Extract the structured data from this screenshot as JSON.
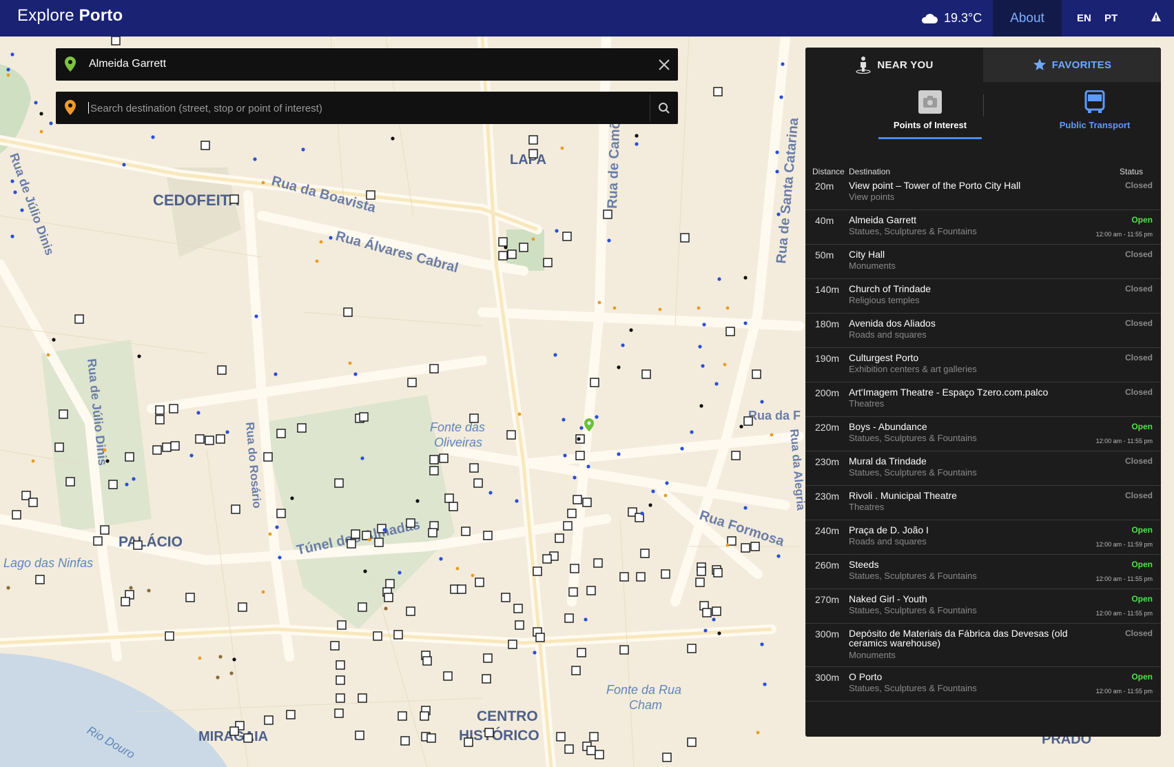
{
  "header": {
    "brand_light": "Explore",
    "brand_bold": "Porto",
    "weather": "19.3°C",
    "about": "About",
    "lang_en": "EN",
    "lang_pt": "PT"
  },
  "search": {
    "origin_value": "Almeida Garrett",
    "destination_placeholder": "Search destination (street, stop or point of interest)"
  },
  "map": {
    "labels": {
      "cedofeita": "CEDOFEITA",
      "lapa": "LAPA",
      "palacio": "PALÁCIO",
      "miragaia": "MIRAGAIA",
      "centro1": "CENTRO",
      "centro2": "HISTÓRICO",
      "prado": "PRADO",
      "boavista": "Rua da Boavista",
      "alvares": "Rua Álvares Cabral",
      "julio1": "Rua de Júlio Dinis",
      "julio2": "Rua de Júlio Dinis",
      "rosario": "Rua do Rosário",
      "almadas": "Túnel dos Almadas",
      "santacatarina": "Rua de Santa Catarina",
      "camoes": "Rua de Camões",
      "alegria": "Rua da Alegria",
      "formosa": "Rua Formosa",
      "ruadaf": "Rua da F",
      "fonte_oliveiras1": "Fonte das",
      "fonte_oliveiras2": "Oliveiras",
      "lago1": "Lago das Ninfas",
      "fonte_rua1": "Fonte da Rua",
      "fonte_rua2": "Cham",
      "rio": "Rio Douro"
    }
  },
  "panel": {
    "tab_near": "NEAR YOU",
    "tab_favorites": "FAVORITES",
    "subtab_poi": "Points of Interest",
    "subtab_transport": "Public Transport",
    "col_distance": "Distance",
    "col_destination": "Destination",
    "col_status": "Status",
    "rows": [
      {
        "dist": "20m",
        "title": "View point – Tower of the Porto City Hall",
        "cat": "View points",
        "status": "Closed",
        "hours": ""
      },
      {
        "dist": "40m",
        "title": "Almeida Garrett",
        "cat": "Statues, Sculptures & Fountains",
        "status": "Open",
        "hours": "12:00 am - 11:55 pm"
      },
      {
        "dist": "50m",
        "title": "City Hall",
        "cat": "Monuments",
        "status": "Closed",
        "hours": ""
      },
      {
        "dist": "140m",
        "title": "Church of Trindade",
        "cat": "Religious temples",
        "status": "Closed",
        "hours": ""
      },
      {
        "dist": "180m",
        "title": "Avenida dos Aliados",
        "cat": "Roads and squares",
        "status": "Closed",
        "hours": ""
      },
      {
        "dist": "190m",
        "title": "Culturgest Porto",
        "cat": "Exhibition centers & art galleries",
        "status": "Closed",
        "hours": ""
      },
      {
        "dist": "200m",
        "title": "Art'Imagem Theatre - Espaço Tzero.com.palco",
        "cat": "Theatres",
        "status": "Closed",
        "hours": ""
      },
      {
        "dist": "220m",
        "title": "Boys - Abundance",
        "cat": "Statues, Sculptures & Fountains",
        "status": "Open",
        "hours": "12:00 am - 11:55 pm"
      },
      {
        "dist": "230m",
        "title": "Mural da Trindade",
        "cat": "Statues, Sculptures & Fountains",
        "status": "Closed",
        "hours": ""
      },
      {
        "dist": "230m",
        "title": "Rivoli . Municipal Theatre",
        "cat": "Theatres",
        "status": "Closed",
        "hours": ""
      },
      {
        "dist": "240m",
        "title": "Praça de D. João I",
        "cat": "Roads and squares",
        "status": "Open",
        "hours": "12:00 am - 11:59 pm"
      },
      {
        "dist": "260m",
        "title": "Steeds",
        "cat": "Statues, Sculptures & Fountains",
        "status": "Open",
        "hours": "12:00 am - 11:55 pm"
      },
      {
        "dist": "270m",
        "title": "Naked Girl - Youth",
        "cat": "Statues, Sculptures & Fountains",
        "status": "Open",
        "hours": "12:00 am - 11:55 pm"
      },
      {
        "dist": "300m",
        "title": "Depósito de Materiais da Fábrica das Devesas (old ceramics warehouse)",
        "cat": "Monuments",
        "status": "Closed",
        "hours": ""
      },
      {
        "dist": "300m",
        "title": "O Porto",
        "cat": "Statues, Sculptures & Fountains",
        "status": "Open",
        "hours": "12:00 am - 11:55 pm"
      }
    ]
  },
  "colors": {
    "header_bg": "#1a2273",
    "accent_blue": "#4a8cff",
    "open_green": "#4fe24f"
  }
}
